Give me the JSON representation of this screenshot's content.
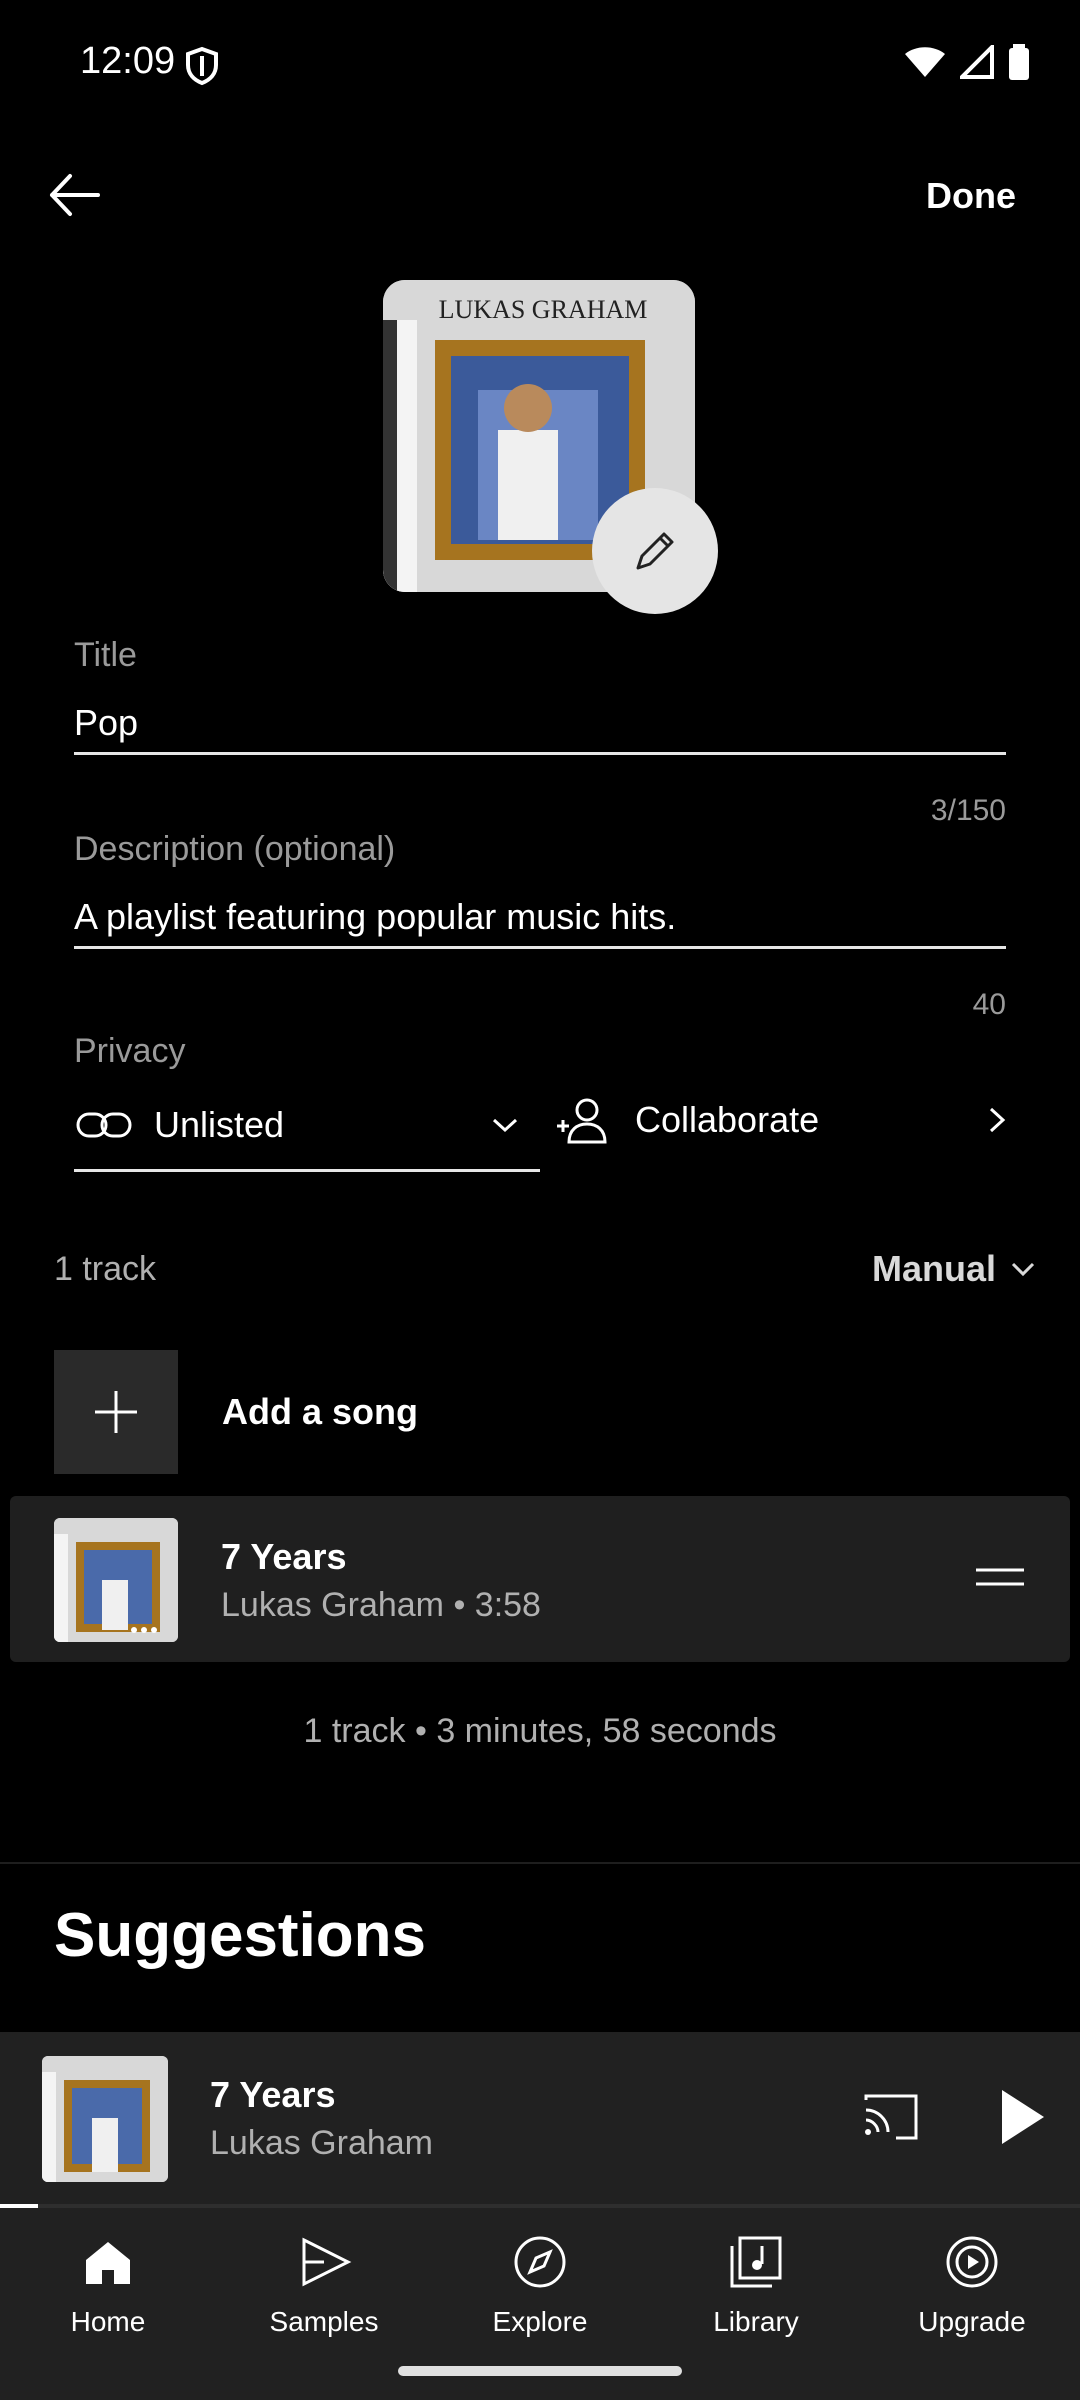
{
  "status_bar": {
    "time": "12:09"
  },
  "header": {
    "done_label": "Done"
  },
  "form": {
    "title_label": "Title",
    "title_value": "Pop",
    "title_counter": "3/150",
    "description_label": "Description (optional)",
    "description_value": "A playlist featuring popular music hits.",
    "description_counter": "40",
    "privacy_label": "Privacy",
    "privacy_value": "Unlisted",
    "collaborate_label": "Collaborate"
  },
  "tracks_section": {
    "count_label": "1 track",
    "sort_label": "Manual",
    "add_song_label": "Add a song",
    "items": [
      {
        "title": "7 Years",
        "subtitle": "Lukas Graham • 3:58"
      }
    ],
    "summary": "1 track • 3 minutes, 58 seconds"
  },
  "suggestions": {
    "heading": "Suggestions"
  },
  "cover_art": {
    "text": "LUKAS GRAHAM"
  },
  "mini_player": {
    "title": "7 Years",
    "artist": "Lukas Graham",
    "progress_fraction": 0.035
  },
  "bottom_nav": {
    "items": [
      {
        "label": "Home",
        "icon": "home-icon",
        "active": true
      },
      {
        "label": "Samples",
        "icon": "samples-icon",
        "active": false
      },
      {
        "label": "Explore",
        "icon": "explore-icon",
        "active": false
      },
      {
        "label": "Library",
        "icon": "library-icon",
        "active": false
      },
      {
        "label": "Upgrade",
        "icon": "upgrade-icon",
        "active": false
      }
    ]
  },
  "colors": {
    "background": "#000000",
    "surface": "#212121",
    "muted_text": "#b0b0b0"
  }
}
